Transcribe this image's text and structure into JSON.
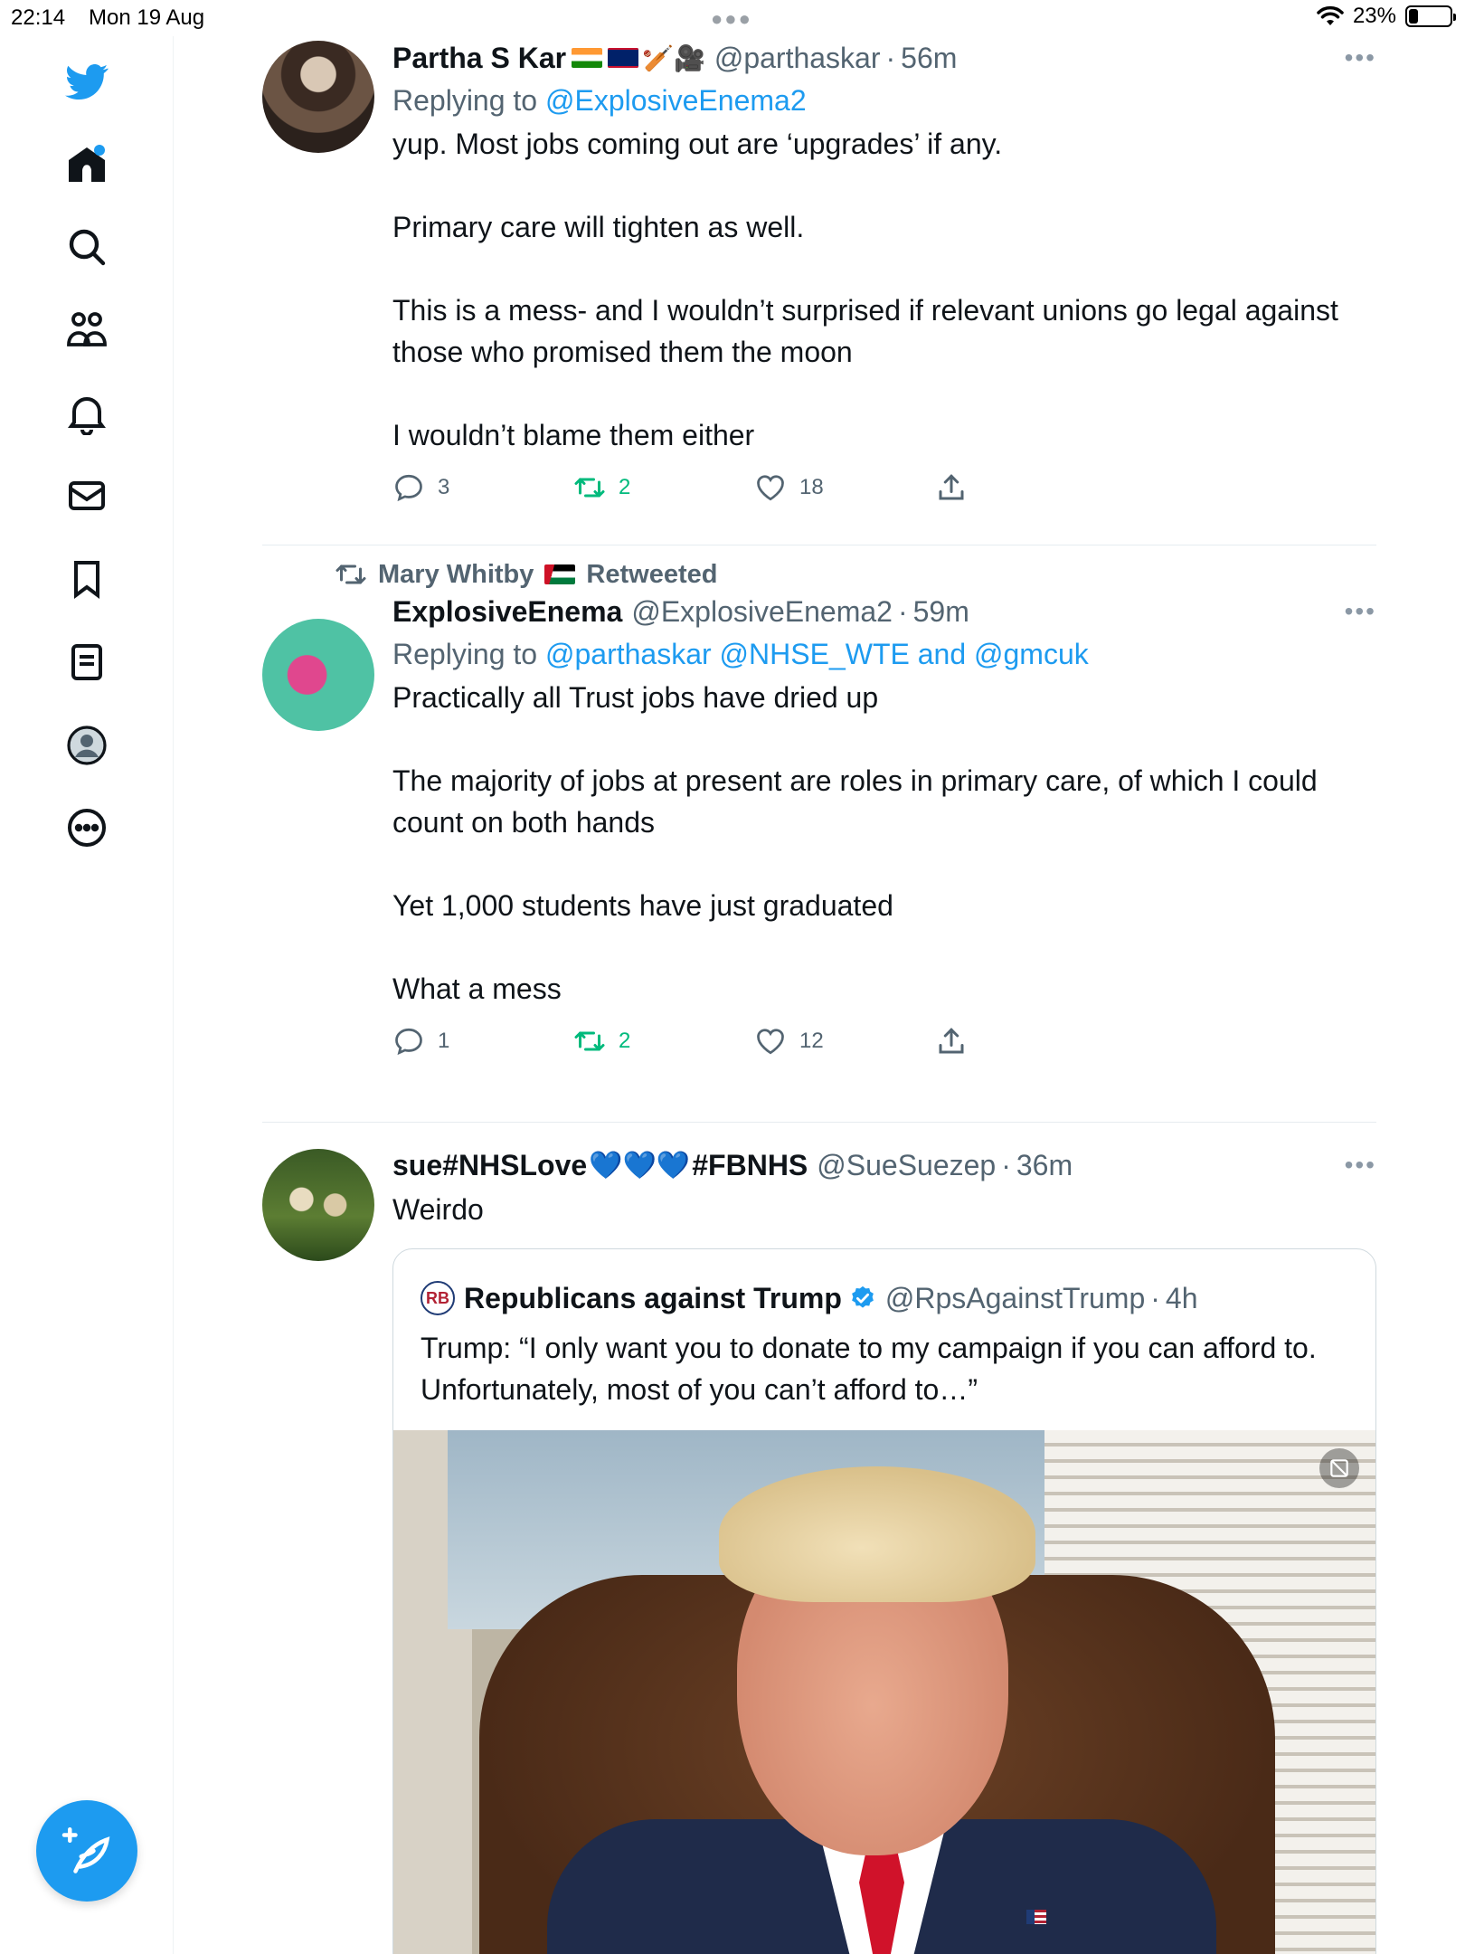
{
  "status_bar": {
    "time": "22:14",
    "date": "Mon 19 Aug",
    "battery": "23%",
    "battery_level": 0.23
  },
  "sidebar": {
    "items": [
      {
        "icon": "twitter-bird-icon"
      },
      {
        "icon": "home-icon",
        "notification_dot": true
      },
      {
        "icon": "search-icon"
      },
      {
        "icon": "communities-icon"
      },
      {
        "icon": "notifications-bell-icon"
      },
      {
        "icon": "messages-envelope-icon"
      },
      {
        "icon": "bookmark-icon"
      },
      {
        "icon": "lists-icon"
      },
      {
        "icon": "profile-icon"
      },
      {
        "icon": "more-icon"
      }
    ],
    "compose_icon": "compose-feather-icon"
  },
  "colors": {
    "accent": "#1d9bf0",
    "retweet": "#00ba7c",
    "secondary_text": "#536471"
  },
  "tweets": [
    {
      "name": "Partha S Kar",
      "handle": "@parthaskar",
      "time": "56m",
      "replying_label": "Replying to",
      "replying_to": "@ExplosiveEnema2",
      "paragraphs": [
        "yup. Most jobs coming out are ‘upgrades’ if any.",
        "Primary care will tighten as well.",
        "This is a mess- and I wouldn’t surprised if relevant unions go legal against those who promised them the moon",
        "I wouldn’t blame them either"
      ],
      "replies": "3",
      "retweets": "2",
      "likes": "18"
    },
    {
      "retweeted_by": "Mary Whitby",
      "retweeted_label": "Retweeted",
      "name": "ExplosiveEnema",
      "handle": "@ExplosiveEnema2",
      "time": "59m",
      "replying_label": "Replying to",
      "replying_to": "@parthaskar @NHSE_WTE and @gmcuk",
      "paragraphs": [
        "Practically all Trust jobs have dried up",
        "The majority of jobs at present are roles in primary care, of which I could count on both hands",
        "Yet 1,000 students have just graduated",
        "What a mess"
      ],
      "replies": "1",
      "retweets": "2",
      "likes": "12"
    },
    {
      "name_prefix": "sue#NHSLove",
      "name_hearts": "💙💙💙",
      "name_suffix": "#FBNHS",
      "handle": "@SueSuezep",
      "time": "36m",
      "text": "Weirdo",
      "quote": {
        "name": "Republicans against Trump",
        "handle": "@RpsAgainstTrump",
        "time": "4h",
        "text": "Trump: “I only want you to donate to my campaign if you can afford to. Unfortunately, most of you can’t afford to…”",
        "avatar_initials": "RB"
      }
    }
  ]
}
